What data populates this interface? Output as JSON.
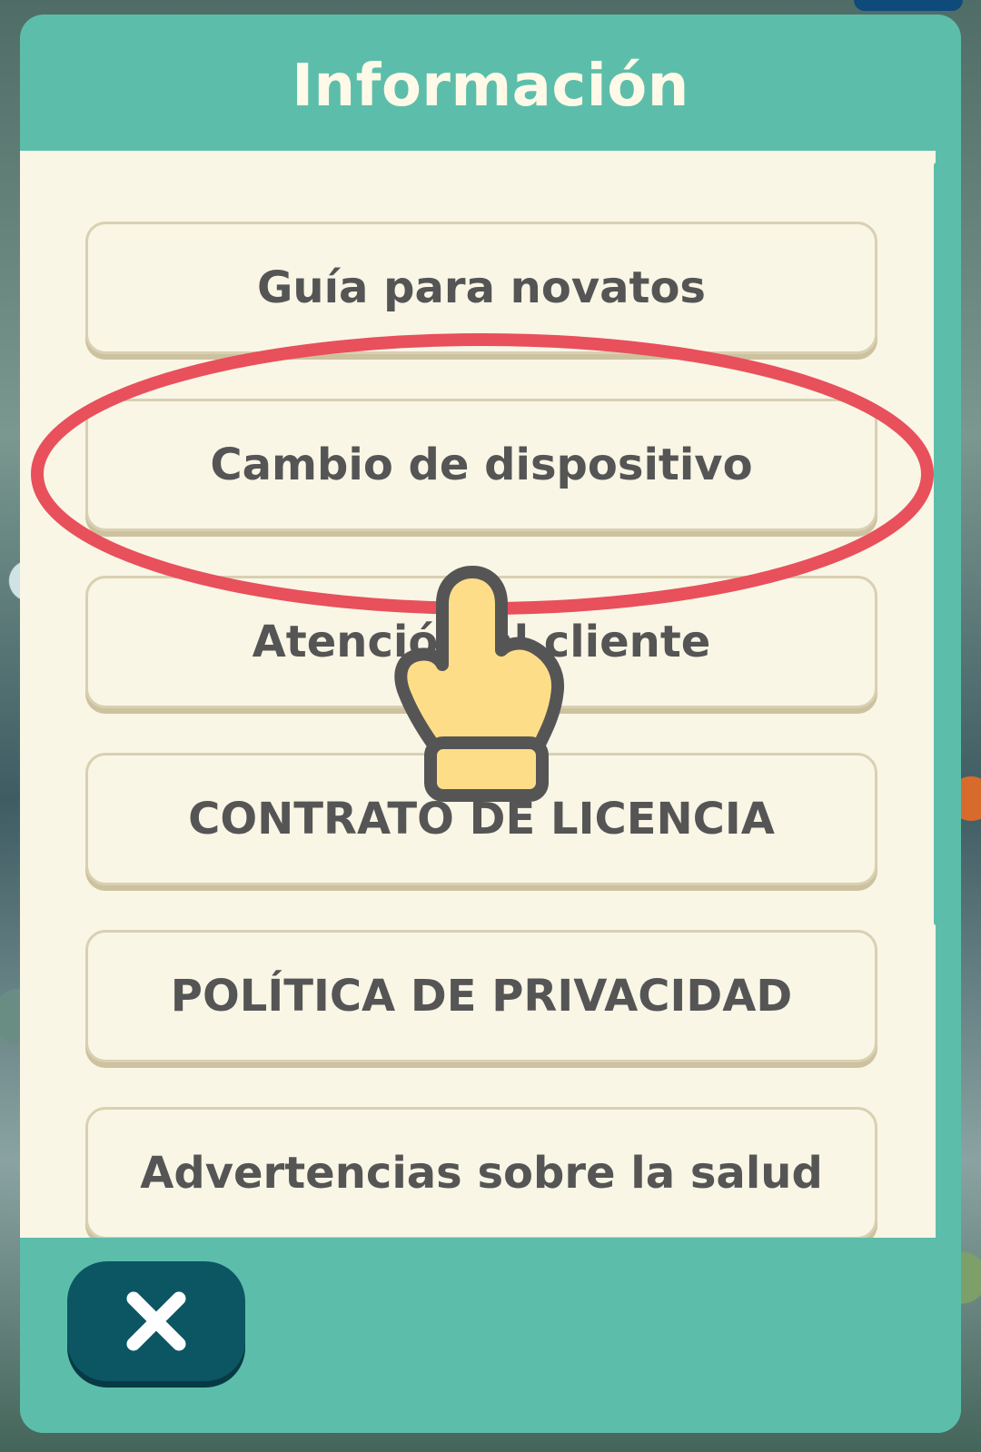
{
  "dialog": {
    "title": "Información",
    "items": [
      {
        "label": "Guía para novatos"
      },
      {
        "label": "Cambio de dispositivo"
      },
      {
        "label": "Atención al cliente"
      },
      {
        "label": "CONTRATO DE LICENCIA"
      },
      {
        "label": "POLÍTICA DE PRIVACIDAD"
      },
      {
        "label": "Advertencias sobre la salud"
      }
    ],
    "close_icon": "close-x-icon"
  },
  "annotation": {
    "highlight_color": "#e8505b",
    "pointer_icon": "pointing-hand-icon",
    "highlighted_item": "Cambio de dispositivo"
  },
  "colors": {
    "header": "#5cbeaa",
    "body": "#f9f6e6",
    "button_text": "#555555",
    "close_button": "#0c5664"
  }
}
